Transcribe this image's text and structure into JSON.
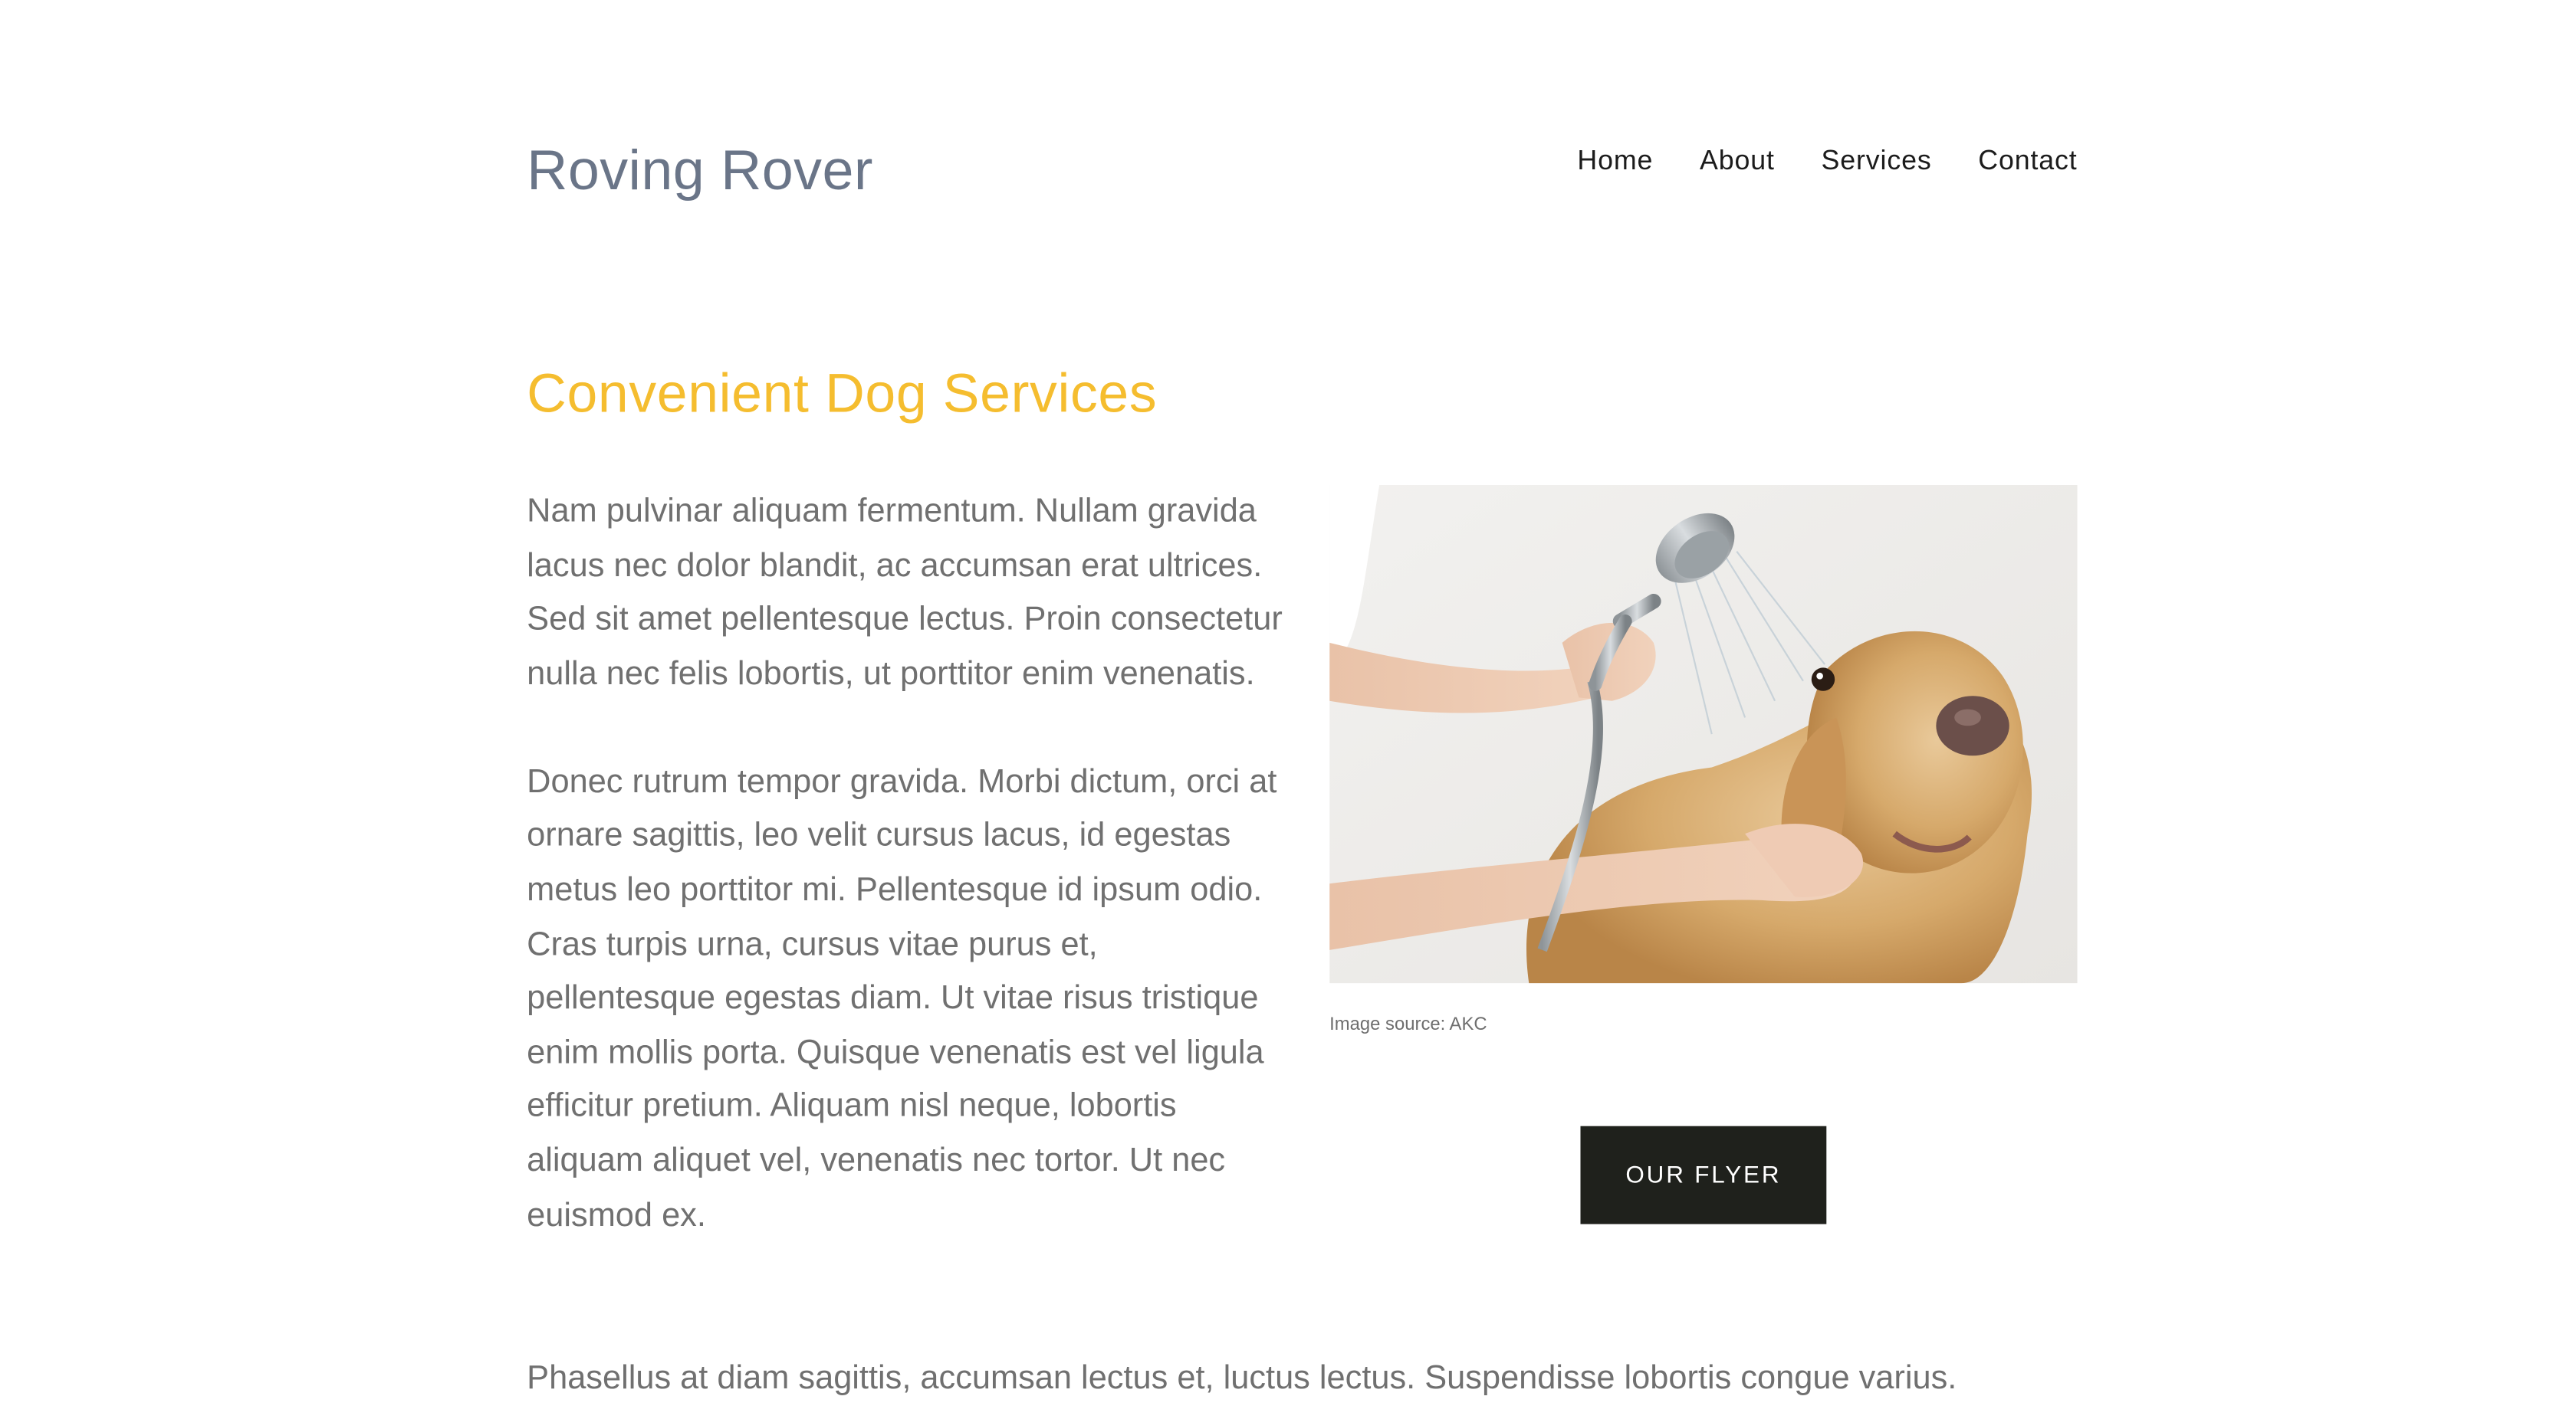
{
  "header": {
    "brand": "Roving Rover",
    "nav": [
      {
        "label": "Home"
      },
      {
        "label": "About"
      },
      {
        "label": "Services"
      },
      {
        "label": "Contact"
      }
    ]
  },
  "main": {
    "heading": "Convenient Dog Services",
    "paragraphs": [
      "Nam pulvinar aliquam fermentum. Nullam gravida lacus nec dolor blandit, ac accumsan erat ultrices. Sed sit amet pellentesque lectus. Proin consectetur nulla nec felis lobortis, ut porttitor enim venenatis.",
      "Donec rutrum tempor gravida. Morbi dictum, orci at ornare sagittis, leo velit cursus lacus, id egestas metus leo porttitor mi. Pellentesque id ipsum odio. Cras turpis urna, cursus vitae purus et, pellentesque egestas diam. Ut vitae risus tristique enim mollis porta. Quisque venenatis est vel ligula efficitur pretium. Aliquam nisl neque, lobortis aliquam aliquet vel, venenatis nec tortor. Ut nec euismod ex."
    ],
    "full_paragraph": "Phasellus at diam sagittis, accumsan lectus et, luctus lectus. Suspendisse lobortis congue varius.",
    "figure": {
      "icon": "dog-bath-photo",
      "caption": "Image source: AKC"
    },
    "flyer_button": "OUR FLYER"
  },
  "colors": {
    "brand": "#6a7588",
    "heading": "#f5bd2f",
    "body_text": "#707070",
    "button_bg": "#1f211c"
  }
}
